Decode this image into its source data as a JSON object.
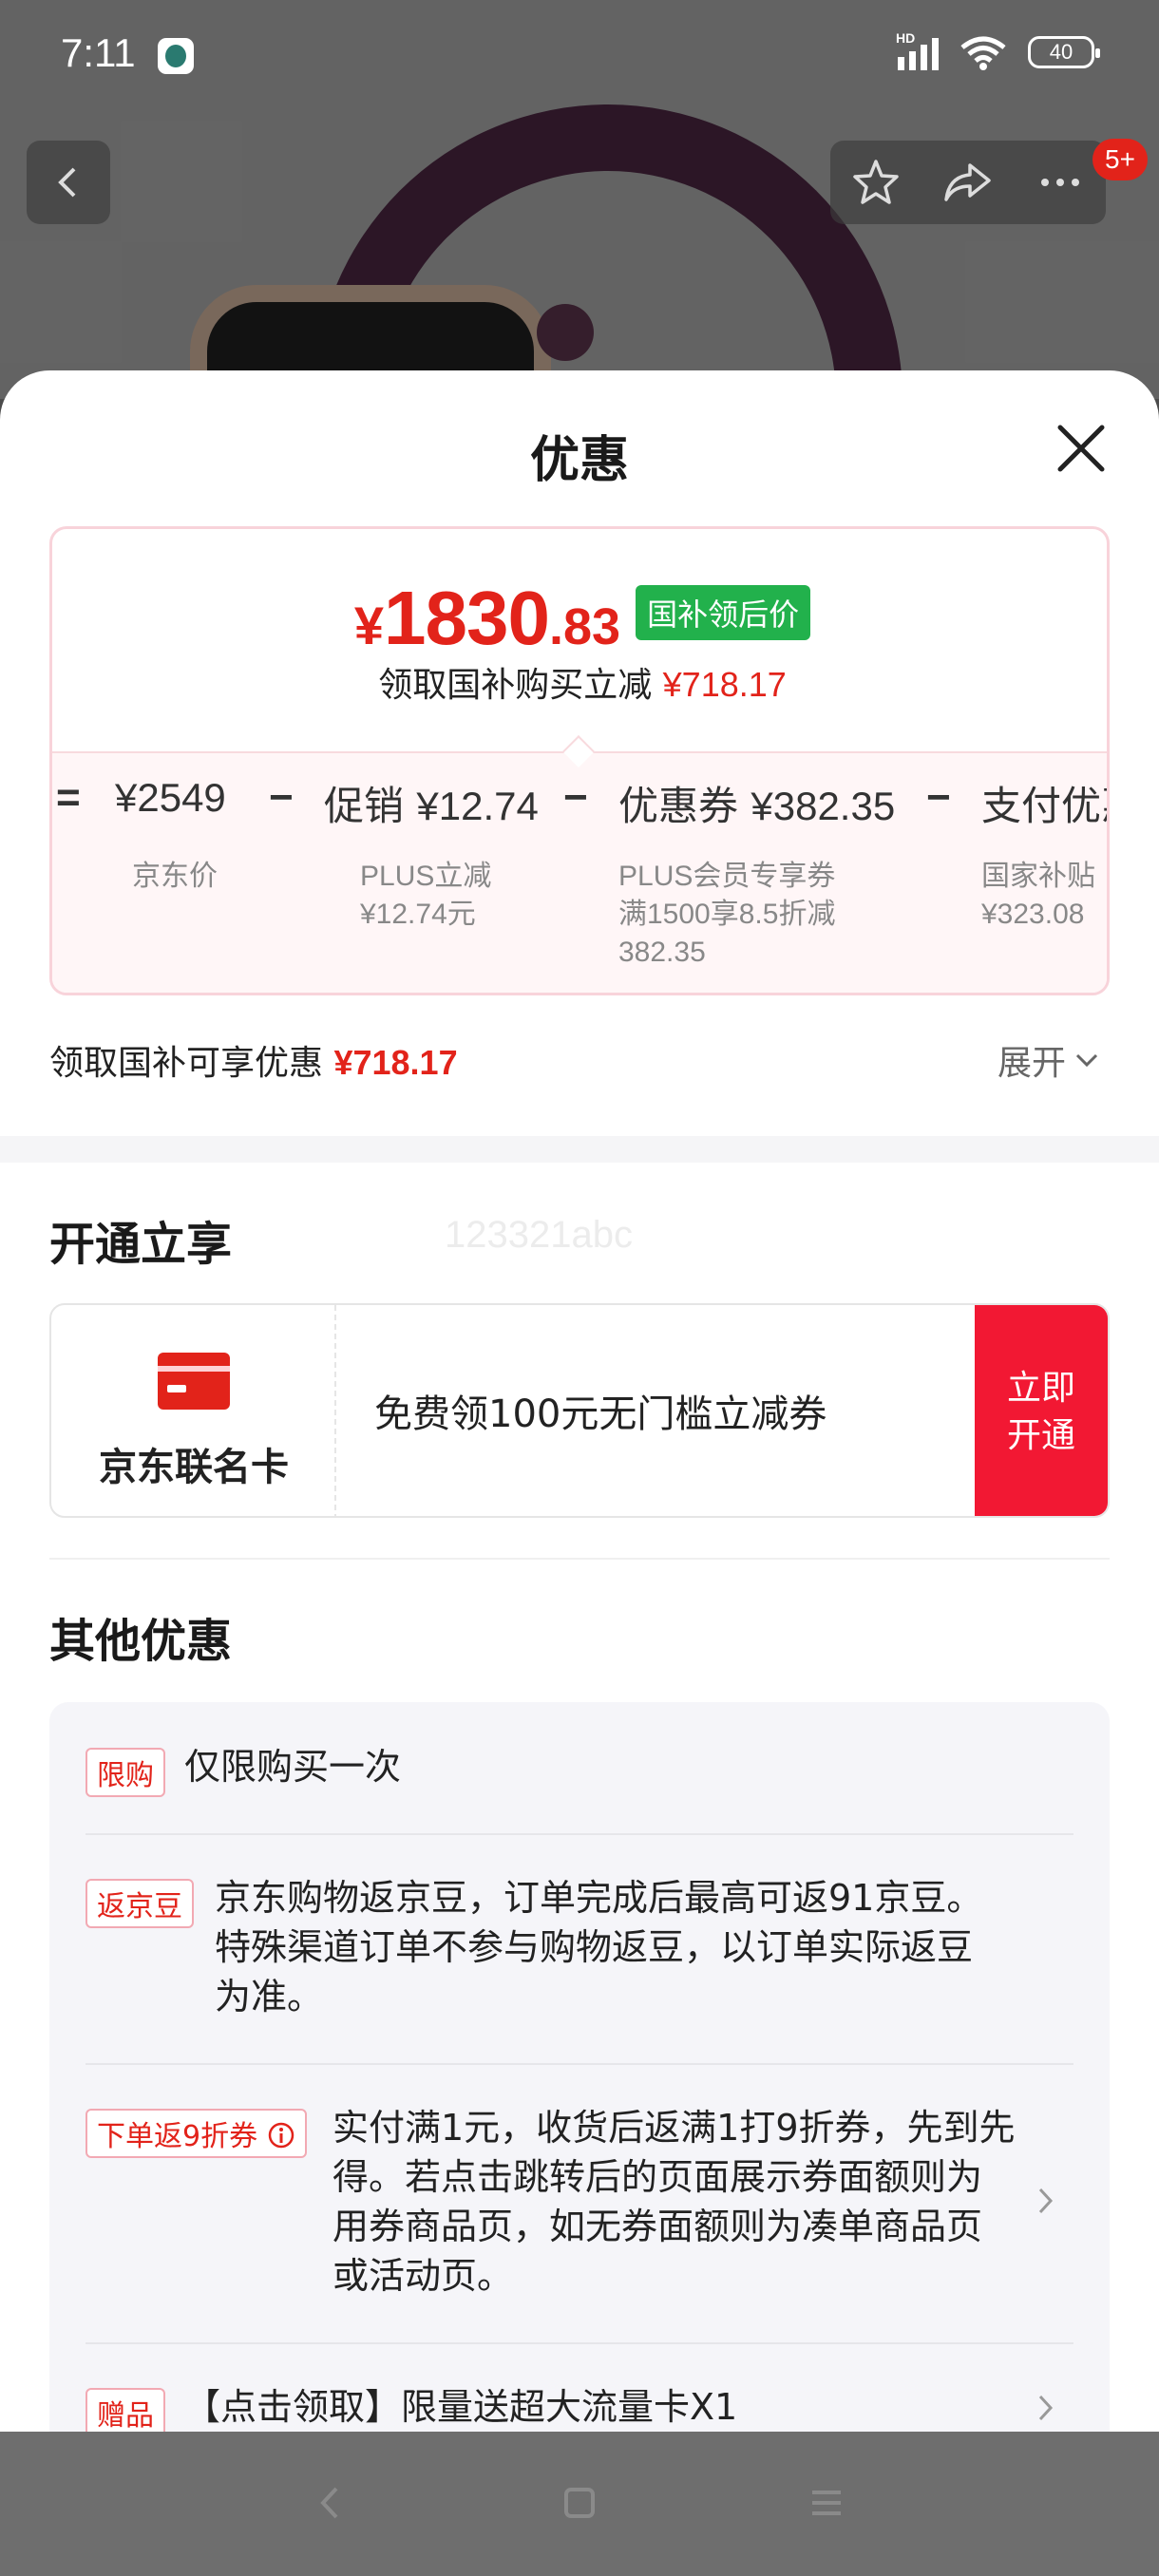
{
  "status_bar": {
    "time": "7:11",
    "network": "HD",
    "battery": "40"
  },
  "top_nav": {
    "cart_badge": "5+"
  },
  "sheet": {
    "title": "优惠",
    "price_card": {
      "yen": "¥",
      "price_int": "1830",
      "price_dec": ".83",
      "price_tag": "国补领后价",
      "save_label": "领取国补购买立减",
      "save_amount": "¥718.17",
      "breakdown": {
        "eq": "=",
        "jd_price": "¥2549",
        "jd_price_label": "京东价",
        "minus1": "−",
        "promo_label": "促销",
        "promo_amount": "¥12.74",
        "promo_sub1": "PLUS立减",
        "promo_sub2": "¥12.74元",
        "minus2": "−",
        "coupon_label": "优惠券",
        "coupon_amount": "¥382.35",
        "coupon_sub1": "PLUS会员专享券",
        "coupon_sub2": "满1500享8.5折减",
        "coupon_sub3": "382.35",
        "minus3": "−",
        "pay_label": "支付优惠",
        "pay_sub1": "国家补贴",
        "pay_sub2": "¥323.08"
      }
    },
    "gov_line": {
      "label": "领取国补可享优惠",
      "amount": "¥718.17",
      "expand": "展开"
    },
    "open_section": {
      "title": "开通立享",
      "watermark": "123321abc",
      "card_name": "京东联名卡",
      "card_offer": "免费领100元无门槛立减券",
      "open_btn_line1": "立即",
      "open_btn_line2": "开通"
    },
    "other_section": {
      "title": "其他优惠",
      "items": [
        {
          "tag": "限购",
          "text": "仅限购买一次"
        },
        {
          "tag": "返京豆",
          "text": [
            "京东购物返京豆，订单完成后最高可返91京豆。",
            "特殊渠道订单不参与购物返豆，以订单实际返豆",
            "为准。"
          ]
        },
        {
          "tag": "下单返9折券",
          "text": [
            "实付满1元，收货后返满1打9折券，先到先",
            "得。若点击跳转后的页面展示券面额则为",
            "用券商品页，如无券面额则为凑单商品页",
            "或活动页。"
          ]
        },
        {
          "tag": "赠品",
          "text": "【点击领取】限量送超大流量卡X1"
        }
      ]
    }
  },
  "colors": {
    "accent_red": "#e2231a",
    "tag_green": "#22b14c",
    "open_button": "#f21833"
  }
}
